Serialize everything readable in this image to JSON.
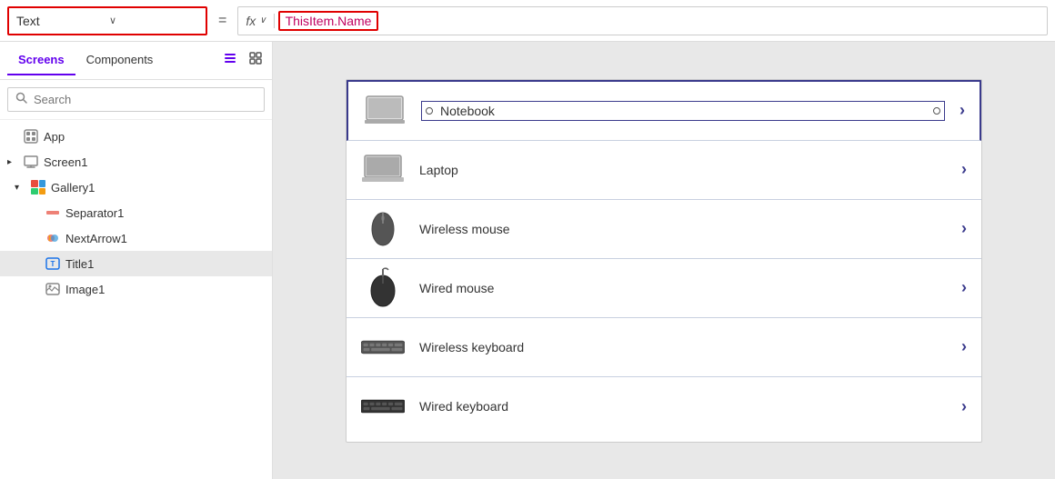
{
  "topbar": {
    "property_label": "Text",
    "equals": "=",
    "fx_label": "fx",
    "formula": "ThisItem.Name",
    "dropdown_chevron": "∨"
  },
  "left_panel": {
    "tabs": [
      {
        "id": "screens",
        "label": "Screens",
        "active": true
      },
      {
        "id": "components",
        "label": "Components",
        "active": false
      }
    ],
    "list_icon_label": "≡",
    "grid_icon_label": "⊞",
    "search_placeholder": "Search",
    "tree": [
      {
        "id": "app",
        "label": "App",
        "indent": 0,
        "icon": "app",
        "expanded": false,
        "chevron": ""
      },
      {
        "id": "screen1",
        "label": "Screen1",
        "indent": 0,
        "icon": "screen",
        "expanded": true,
        "chevron": "▶"
      },
      {
        "id": "gallery1",
        "label": "Gallery1",
        "indent": 1,
        "icon": "gallery",
        "expanded": true,
        "chevron": "▼"
      },
      {
        "id": "separator1",
        "label": "Separator1",
        "indent": 2,
        "icon": "separator",
        "expanded": false,
        "chevron": ""
      },
      {
        "id": "nextarrow1",
        "label": "NextArrow1",
        "indent": 2,
        "icon": "nextarrow",
        "expanded": false,
        "chevron": ""
      },
      {
        "id": "title1",
        "label": "Title1",
        "indent": 2,
        "icon": "title",
        "expanded": false,
        "chevron": "",
        "selected": true
      },
      {
        "id": "image1",
        "label": "Image1",
        "indent": 2,
        "icon": "image",
        "expanded": false,
        "chevron": ""
      }
    ]
  },
  "gallery": {
    "items": [
      {
        "id": "notebook",
        "name": "Notebook",
        "device": "notebook",
        "chevron": "›",
        "selected": true
      },
      {
        "id": "laptop",
        "name": "Laptop",
        "device": "laptop",
        "chevron": "›",
        "selected": false
      },
      {
        "id": "wireless_mouse",
        "name": "Wireless mouse",
        "device": "wireless-mouse",
        "chevron": "›",
        "selected": false
      },
      {
        "id": "wired_mouse",
        "name": "Wired mouse",
        "device": "wired-mouse",
        "chevron": "›",
        "selected": false
      },
      {
        "id": "wireless_keyboard",
        "name": "Wireless keyboard",
        "device": "wireless-keyboard",
        "chevron": "›",
        "selected": false
      },
      {
        "id": "wired_keyboard",
        "name": "Wired keyboard",
        "device": "wired-keyboard",
        "chevron": "›",
        "selected": false
      }
    ]
  },
  "colors": {
    "accent_purple": "#6200ee",
    "accent_navy": "#3a3a8c",
    "formula_pink": "#c00060",
    "border_red": "#e00000"
  }
}
